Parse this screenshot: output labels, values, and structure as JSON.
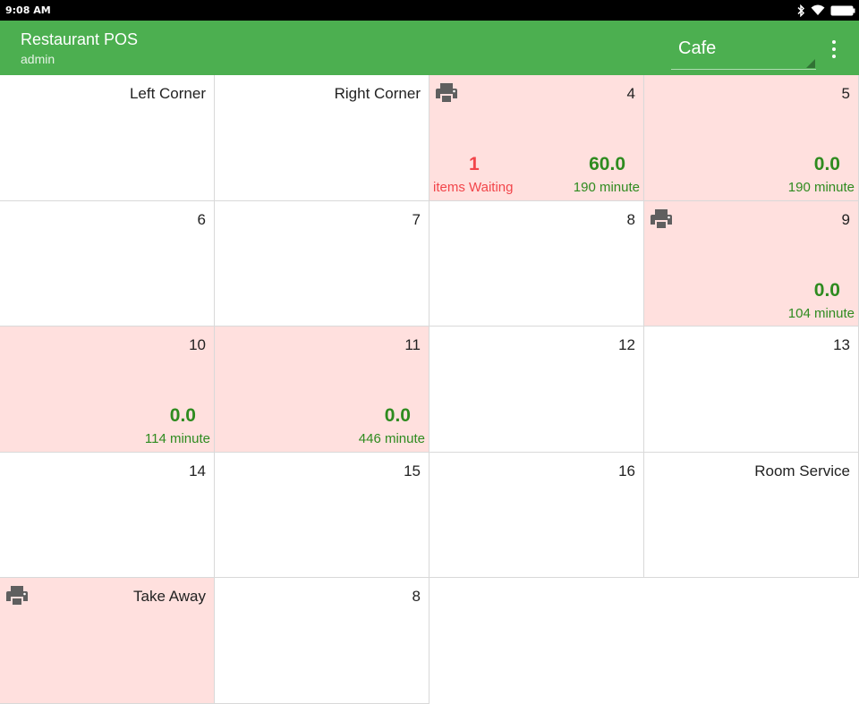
{
  "status_bar": {
    "time": "9:08 AM"
  },
  "app_bar": {
    "title": "Restaurant POS",
    "subtitle": "admin",
    "area_selector": {
      "selected": "Cafe"
    }
  },
  "colors": {
    "primary": "#4caf50",
    "occupied_bg": "#ffe0de",
    "amount_green": "#2e8b1f",
    "waiting_red": "#f2454a"
  },
  "tables": [
    {
      "name": "Left Corner"
    },
    {
      "name": "Right Corner"
    },
    {
      "name": "4",
      "occupied": true,
      "printer": true,
      "amount": "60.0",
      "minutes": "190 minute",
      "waiting_count": "1",
      "waiting_label": "items Waiting"
    },
    {
      "name": "5",
      "occupied": true,
      "amount": "0.0",
      "minutes": "190 minute"
    },
    {
      "name": "6"
    },
    {
      "name": "7"
    },
    {
      "name": "8"
    },
    {
      "name": "9",
      "occupied": true,
      "printer": true,
      "amount": "0.0",
      "minutes": "104 minute"
    },
    {
      "name": "10",
      "occupied": true,
      "amount": "0.0",
      "minutes": "114 minute"
    },
    {
      "name": "11",
      "occupied": true,
      "amount": "0.0",
      "minutes": "446 minute"
    },
    {
      "name": "12"
    },
    {
      "name": "13"
    },
    {
      "name": "14"
    },
    {
      "name": "15"
    },
    {
      "name": "16"
    },
    {
      "name": "Room Service"
    },
    {
      "name": "Take Away",
      "occupied": true,
      "printer": true
    },
    {
      "name": "8"
    }
  ]
}
